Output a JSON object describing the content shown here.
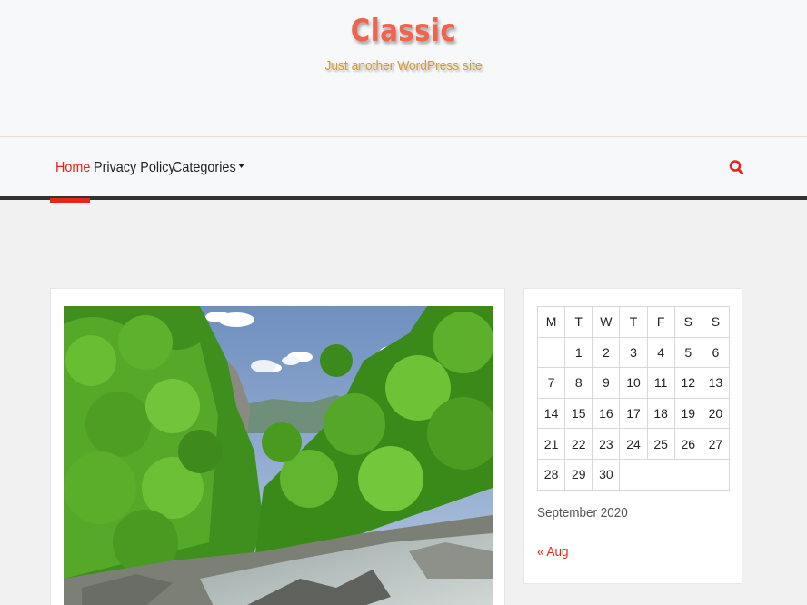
{
  "site": {
    "title": "Classic",
    "description": "Just another WordPress site"
  },
  "nav": {
    "home": "Home",
    "privacy": "Privacy Policy",
    "categories": "Categories"
  },
  "icons": {
    "search": "search-icon",
    "caret": "caret-down-icon"
  },
  "post": {
    "image": "landscape photo of green forest with river"
  },
  "calendar": {
    "weekdays": [
      "M",
      "T",
      "W",
      "T",
      "F",
      "S",
      "S"
    ],
    "weeks": [
      [
        "",
        "1",
        "2",
        "3",
        "4",
        "5",
        "6"
      ],
      [
        "7",
        "8",
        "9",
        "10",
        "11",
        "12",
        "13"
      ],
      [
        "14",
        "15",
        "16",
        "17",
        "18",
        "19",
        "20"
      ],
      [
        "21",
        "22",
        "23",
        "24",
        "25",
        "26",
        "27"
      ],
      [
        "28",
        "29",
        "30",
        "",
        "",
        "",
        ""
      ]
    ],
    "caption": "September 2020",
    "prev_link": "« Aug"
  },
  "colors": {
    "accent": "#e8251c",
    "title": "#f0644b",
    "tagline": "#d59a2d",
    "nav_border": "#333333"
  }
}
